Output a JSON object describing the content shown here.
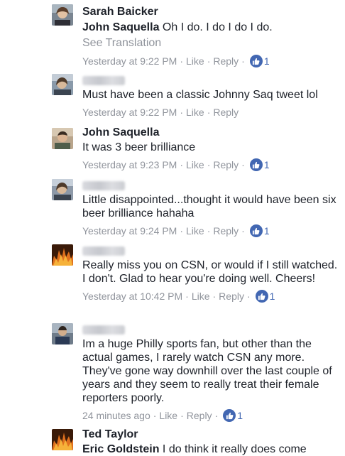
{
  "comments": [
    {
      "author": "Sarah Baicker",
      "reply_to": "John Saquella",
      "text": "Oh I do. I do I do I do.",
      "see_translation": "See Translation",
      "time": "Yesterday at 9:22 PM",
      "like": "Like",
      "reply": "Reply",
      "likes": "1"
    },
    {
      "author_hidden": true,
      "text": "Must have been a classic Johnny Saq tweet lol",
      "time": "Yesterday at 9:22 PM",
      "like": "Like",
      "reply": "Reply"
    },
    {
      "author": "John Saquella",
      "text": "It was 3 beer brilliance",
      "time": "Yesterday at 9:23 PM",
      "like": "Like",
      "reply": "Reply",
      "likes": "1"
    },
    {
      "author_hidden": true,
      "text": "Little disappointed...thought it would have been six beer brilliance hahaha",
      "time": "Yesterday at 9:24 PM",
      "like": "Like",
      "reply": "Reply",
      "likes": "1"
    },
    {
      "author_hidden": true,
      "text": "Really miss you on CSN, or would if I still watched. I don't. Glad to hear you're doing well. Cheers!",
      "time": "Yesterday at 10:42 PM",
      "like": "Like",
      "reply": "Reply",
      "likes": "1"
    },
    {
      "author_hidden": true,
      "text": "Im a huge Philly sports fan, but other than the actual games, I rarely watch CSN any more. They've gone way downhill over the last couple of years and they seem to really treat their female reporters poorly.",
      "time": "24 minutes ago",
      "like": "Like",
      "reply": "Reply",
      "likes": "1"
    },
    {
      "author": "Ted Taylor",
      "reply_to": "Eric Goldstein",
      "text": "I do think it really does come"
    }
  ],
  "colors": {
    "text": "#1d2129",
    "meta": "#90949c",
    "like_badge": "#4267b2"
  },
  "icons": {
    "like_badge": "thumbs-up-icon"
  }
}
